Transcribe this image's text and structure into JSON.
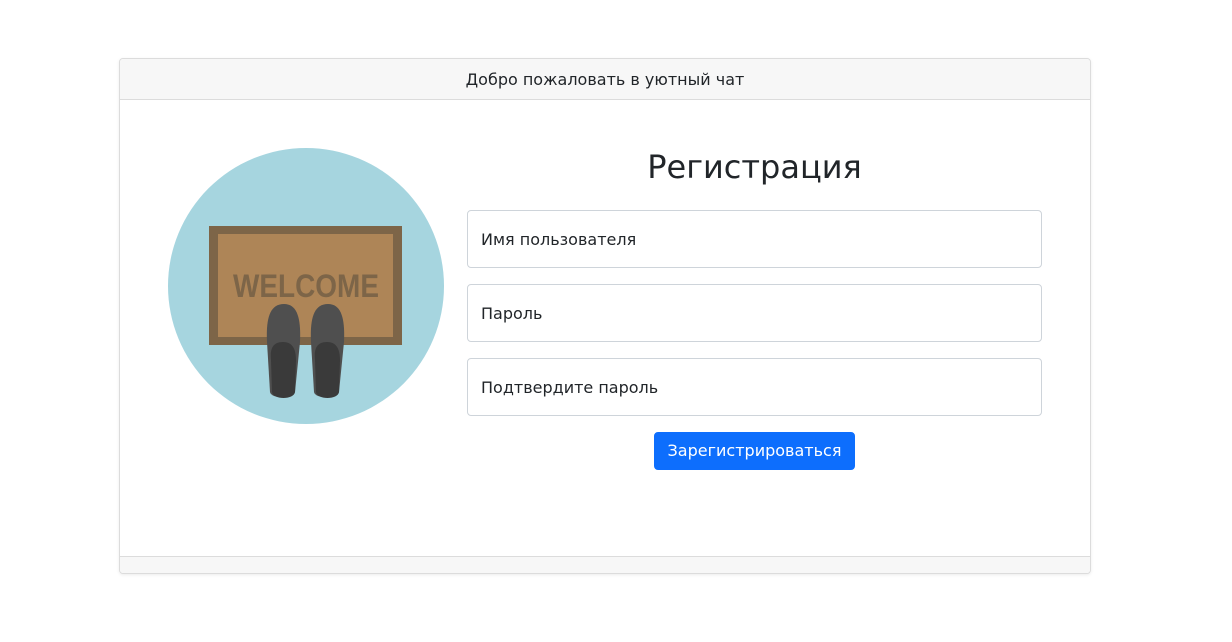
{
  "card": {
    "header_title": "Добро пожаловать в уютный чат"
  },
  "illustration": {
    "mat_text": "WELCOME",
    "icon": "welcome-mat-slippers-icon",
    "colors": {
      "circle": "#a6d5df",
      "mat_border": "#7d6548",
      "mat_fill": "#ae8557",
      "slipper": "#4a4a4a"
    }
  },
  "form": {
    "title": "Регистрация",
    "username_placeholder": "Имя пользователя",
    "password_placeholder": "Пароль",
    "confirm_placeholder": "Подтвердите пароль",
    "submit_label": "Зарегистрироваться"
  },
  "colors": {
    "accent": "#0d6efd",
    "header_bg": "#f7f7f7"
  }
}
